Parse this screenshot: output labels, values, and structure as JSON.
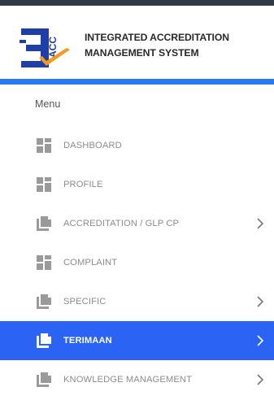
{
  "brand": {
    "title_line1": "INTEGRATED ACCREDITATION",
    "title_line2": "MANAGEMENT SYSTEM",
    "logo_text": "ACC"
  },
  "menu": {
    "heading": "Menu",
    "items": [
      {
        "label": "DASHBOARD",
        "icon": "grid-icon",
        "has_submenu": false,
        "active": false
      },
      {
        "label": "PROFILE",
        "icon": "grid-icon",
        "has_submenu": false,
        "active": false
      },
      {
        "label": "ACCREDITATION / GLP CP",
        "icon": "documents-icon",
        "has_submenu": true,
        "active": false
      },
      {
        "label": "COMPLAINT",
        "icon": "grid-icon",
        "has_submenu": false,
        "active": false
      },
      {
        "label": "SPECIFIC",
        "icon": "documents-icon",
        "has_submenu": true,
        "active": false
      },
      {
        "label": "TERIMAAN",
        "icon": "documents-icon",
        "has_submenu": true,
        "active": true
      },
      {
        "label": "KNOWLEDGE MANAGEMENT",
        "icon": "documents-icon",
        "has_submenu": true,
        "active": false
      }
    ]
  },
  "colors": {
    "accent": "#2979f2",
    "active_bg": "#2b64f5",
    "header_strip": "#2f3a45",
    "logo_blue": "#1f3fa8",
    "logo_orange": "#f39a1e"
  }
}
